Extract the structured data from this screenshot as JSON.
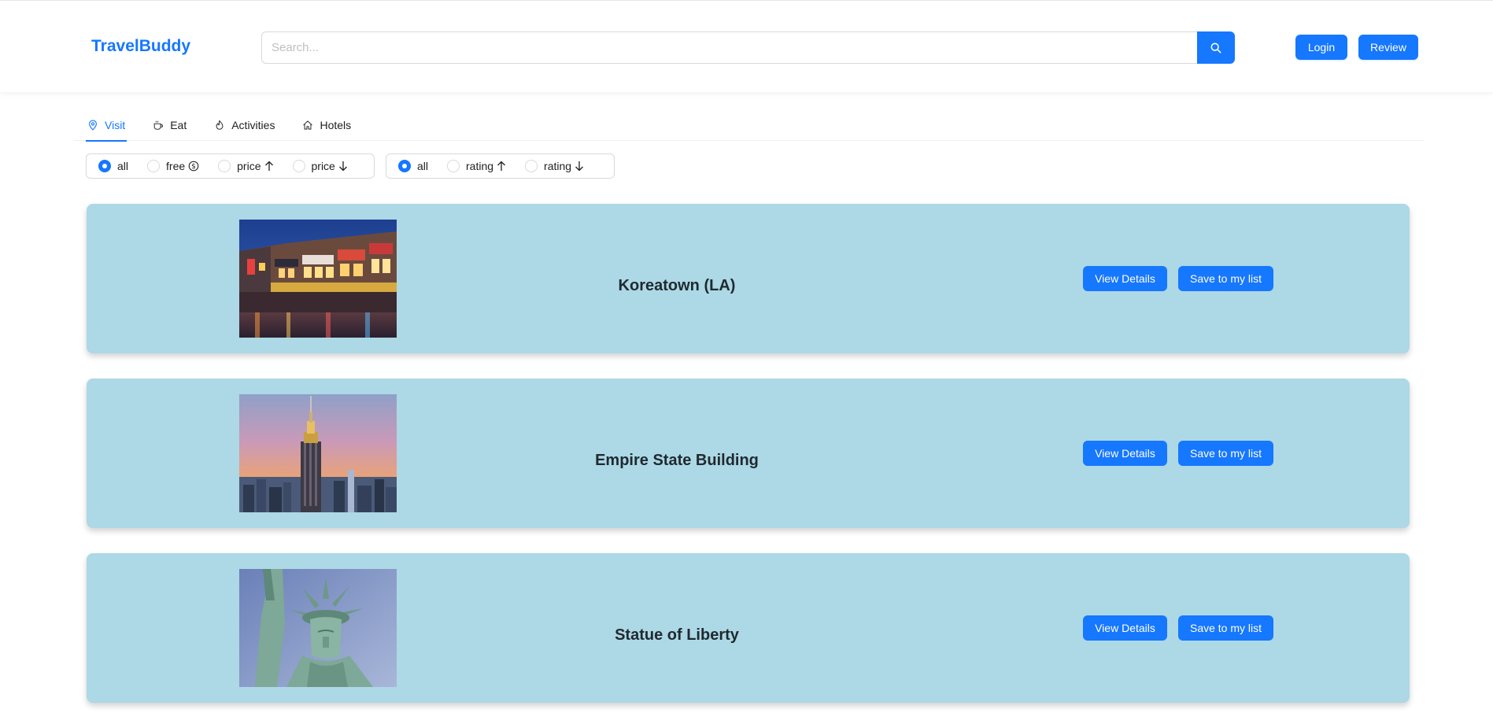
{
  "header": {
    "logo": "TravelBuddy",
    "search_placeholder": "Search...",
    "login_label": "Login",
    "review_label": "Review"
  },
  "tabs": [
    {
      "label": "Visit",
      "icon": "location-pin-icon",
      "active": true
    },
    {
      "label": "Eat",
      "icon": "coffee-icon",
      "active": false
    },
    {
      "label": "Activities",
      "icon": "fire-icon",
      "active": false
    },
    {
      "label": "Hotels",
      "icon": "home-icon",
      "active": false
    }
  ],
  "price_filter": {
    "options": [
      {
        "label": "all",
        "icon": "",
        "checked": true
      },
      {
        "label": "free",
        "icon": "dollar-circle-icon",
        "checked": false
      },
      {
        "label": "price",
        "icon": "arrow-up-icon",
        "checked": false
      },
      {
        "label": "price",
        "icon": "arrow-down-icon",
        "checked": false
      }
    ]
  },
  "rating_filter": {
    "options": [
      {
        "label": "all",
        "icon": "",
        "checked": true
      },
      {
        "label": "rating",
        "icon": "arrow-up-icon",
        "checked": false
      },
      {
        "label": "rating",
        "icon": "arrow-down-icon",
        "checked": false
      }
    ]
  },
  "places": [
    {
      "name": "Koreatown (LA)",
      "view_label": "View Details",
      "save_label": "Save to my list"
    },
    {
      "name": "Empire State Building",
      "view_label": "View Details",
      "save_label": "Save to my list"
    },
    {
      "name": "Statue of Liberty",
      "view_label": "View Details",
      "save_label": "Save to my list"
    }
  ],
  "colors": {
    "accent": "#1677ff",
    "card_background": "#add8e6"
  }
}
